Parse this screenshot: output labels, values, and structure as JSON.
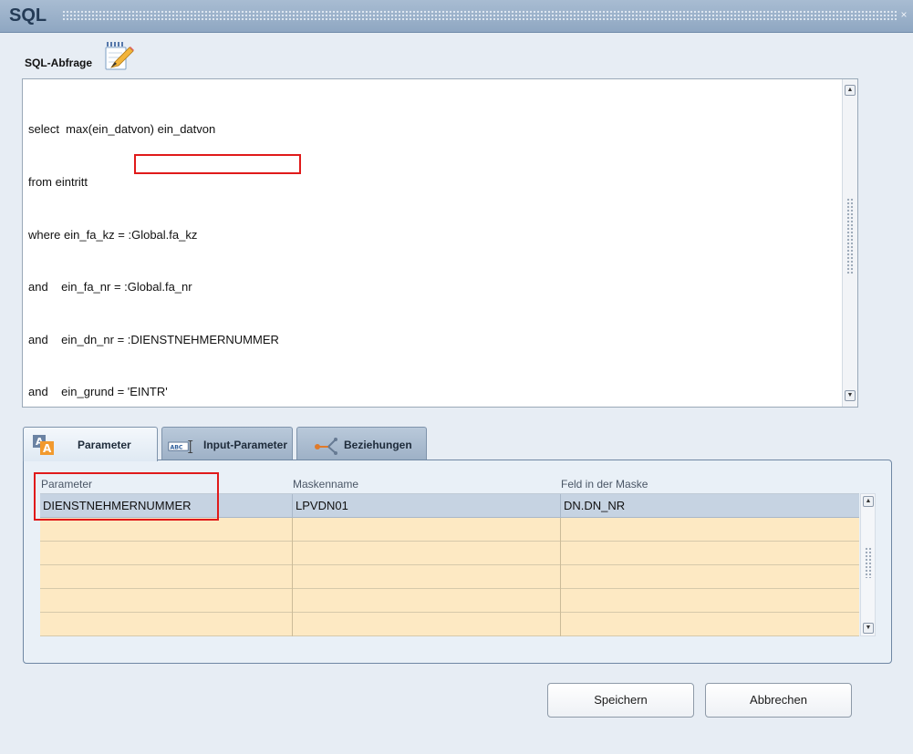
{
  "window": {
    "title": "SQL",
    "close_glyph": "×"
  },
  "query": {
    "label": "SQL-Abfrage",
    "icon": "pencil-notepad-icon",
    "lines": [
      "select  max(ein_datvon) ein_datvon",
      "from eintritt",
      "where ein_fa_kz = :Global.fa_kz",
      "and    ein_fa_nr = :Global.fa_nr",
      "and    ein_dn_nr = :DIENSTNEHMERNUMMER",
      "and    ein_grund = 'EINTR'"
    ]
  },
  "tabs": [
    {
      "label": "Parameter",
      "icon": "parameter-icon",
      "active": true
    },
    {
      "label": "Input-Parameter",
      "icon": "abc-input-icon",
      "active": false
    },
    {
      "label": "Beziehungen",
      "icon": "relations-icon",
      "active": false
    }
  ],
  "table": {
    "columns": [
      "Parameter",
      "Maskenname",
      "Feld in der Maske"
    ],
    "rows": [
      [
        "DIENSTNEHMERNUMMER",
        "LPVDN01",
        "DN.DN_NR"
      ],
      [
        "",
        "",
        ""
      ],
      [
        "",
        "",
        ""
      ],
      [
        "",
        "",
        ""
      ],
      [
        "",
        "",
        ""
      ],
      [
        "",
        "",
        ""
      ]
    ],
    "selected_row": 0
  },
  "buttons": {
    "save": "Speichern",
    "cancel": "Abbrechen"
  },
  "colors": {
    "highlight": "#e01a1a",
    "row_empty": "#fde9c3",
    "row_selected": "#c6d3e2"
  }
}
